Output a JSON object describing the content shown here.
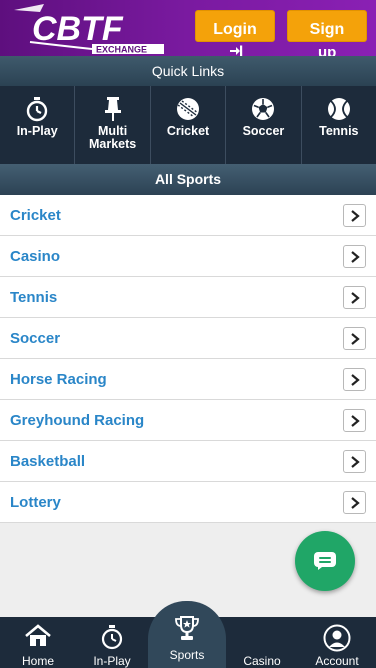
{
  "header": {
    "brand": "CBTF",
    "brand_sub": "EXCHANGE",
    "login_label": "Login",
    "signup_label": "Sign",
    "signup_tail": "up"
  },
  "quick_links": {
    "title": "Quick Links",
    "items": [
      {
        "label": "In-Play",
        "icon": "stopwatch-icon"
      },
      {
        "label": "Multi\nMarkets",
        "label_line1": "Multi",
        "label_line2": "Markets",
        "icon": "pin-icon"
      },
      {
        "label": "Cricket",
        "icon": "cricket-ball-icon"
      },
      {
        "label": "Soccer",
        "icon": "soccer-ball-icon"
      },
      {
        "label": "Tennis",
        "icon": "tennis-ball-icon"
      }
    ]
  },
  "all_sports": {
    "title": "All Sports",
    "items": [
      {
        "label": "Cricket"
      },
      {
        "label": "Casino"
      },
      {
        "label": "Tennis"
      },
      {
        "label": "Soccer"
      },
      {
        "label": "Horse Racing"
      },
      {
        "label": "Greyhound Racing"
      },
      {
        "label": "Basketball"
      },
      {
        "label": "Lottery"
      }
    ]
  },
  "bottom_nav": {
    "items": [
      {
        "label": "Home",
        "icon": "home-icon"
      },
      {
        "label": "In-Play",
        "icon": "stopwatch-icon"
      },
      {
        "label": "Sports",
        "icon": "trophy-icon",
        "active": true
      },
      {
        "label": "Casino",
        "icon": "casino-icon"
      },
      {
        "label": "Account",
        "icon": "user-icon"
      }
    ]
  },
  "colors": {
    "header_purple": "#7a1aa0",
    "button_orange": "#f4a20a",
    "nav_dark": "#1d2b3b",
    "link_blue": "#2a86c8",
    "chat_green": "#20a667"
  }
}
